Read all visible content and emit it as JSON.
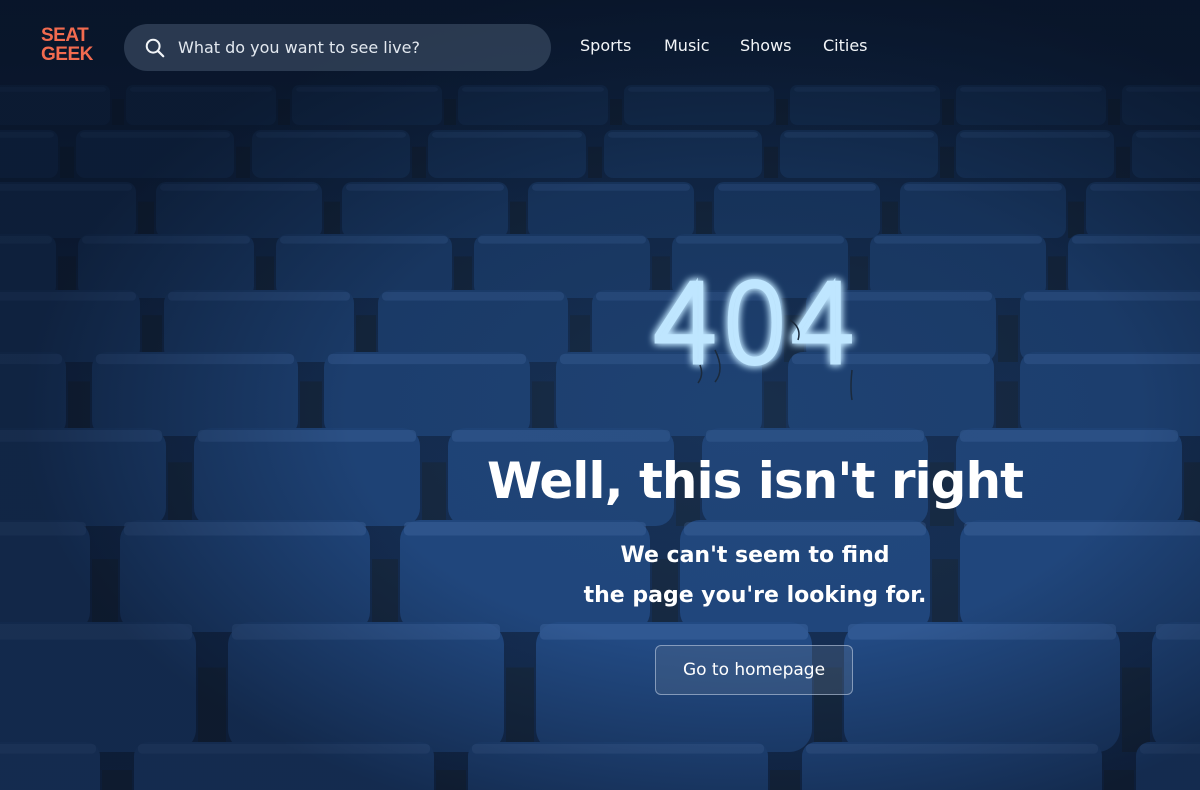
{
  "brand": {
    "logo_line1": "SEAT",
    "logo_line2": "GEEK",
    "logo_color": "#f26b4f"
  },
  "search": {
    "placeholder": "What do you want to see live?",
    "icon": "search-icon"
  },
  "nav": {
    "items": [
      "Sports",
      "Music",
      "Shows",
      "Cities"
    ]
  },
  "error": {
    "code": "404",
    "headline": "Well, this isn't right",
    "message_line1": "We can't seem to find",
    "message_line2": "the page you're looking for.",
    "button_label": "Go to homepage"
  },
  "colors": {
    "background": "#0f2442",
    "neon": "#bfe6ff",
    "text": "#ffffff"
  }
}
